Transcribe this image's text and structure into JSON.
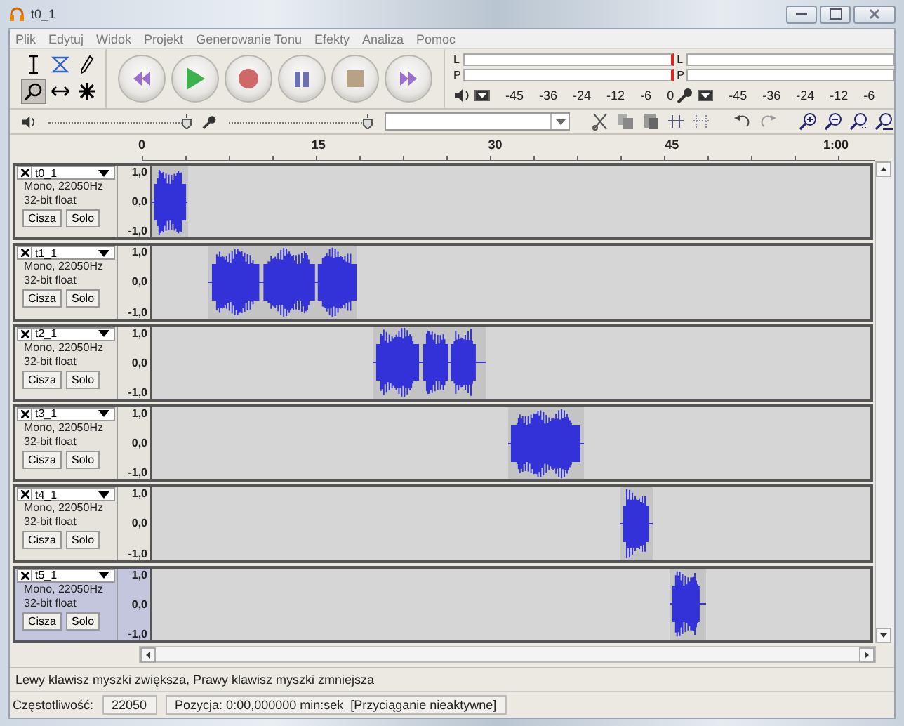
{
  "window": {
    "title": "t0_1"
  },
  "menu": [
    "Plik",
    "Edytuj",
    "Widok",
    "Projekt",
    "Generowanie Tonu",
    "Efekty",
    "Analiza",
    "Pomoc"
  ],
  "tools": [
    {
      "kind": "select",
      "selected": false
    },
    {
      "kind": "envelope",
      "selected": false
    },
    {
      "kind": "draw",
      "selected": false
    },
    {
      "kind": "zoom",
      "selected": true
    },
    {
      "kind": "timeshift",
      "selected": false
    },
    {
      "kind": "multi",
      "selected": false
    }
  ],
  "transport": [
    {
      "kind": "skip-start"
    },
    {
      "kind": "play"
    },
    {
      "kind": "record"
    },
    {
      "kind": "pause"
    },
    {
      "kind": "stop"
    },
    {
      "kind": "skip-end"
    }
  ],
  "meters": [
    {
      "kind": "playback",
      "channels": [
        "L",
        "P"
      ],
      "scale": [
        "-45",
        "-36",
        "-24",
        "-12",
        "-6",
        "0"
      ]
    },
    {
      "kind": "record",
      "channels": [
        "L",
        "P"
      ],
      "scale": [
        "-45",
        "-36",
        "-24",
        "-12",
        "-6"
      ]
    }
  ],
  "mixer": {
    "playback": {
      "level": 0.93
    },
    "record": {
      "level": 0.93
    }
  },
  "ruler": [
    "0",
    "15",
    "30",
    "45",
    "1:00"
  ],
  "tracks": [
    {
      "name": "t0_1",
      "info": "Mono, 22050Hz",
      "format": "32-bit float",
      "buttons": [
        "Cisza",
        "Solo"
      ],
      "scale": [
        "1,0",
        "0,0",
        "-1,0"
      ],
      "selected": false
    },
    {
      "name": "t1_1",
      "info": "Mono, 22050Hz",
      "format": "32-bit float",
      "buttons": [
        "Cisza",
        "Solo"
      ],
      "scale": [
        "1,0",
        "0,0",
        "-1,0"
      ],
      "selected": false
    },
    {
      "name": "t2_1",
      "info": "Mono, 22050Hz",
      "format": "32-bit float",
      "buttons": [
        "Cisza",
        "Solo"
      ],
      "scale": [
        "1,0",
        "0,0",
        "-1,0"
      ],
      "selected": false
    },
    {
      "name": "t3_1",
      "info": "Mono, 22050Hz",
      "format": "32-bit float",
      "buttons": [
        "Cisza",
        "Solo"
      ],
      "scale": [
        "1,0",
        "0,0",
        "-1,0"
      ],
      "selected": false
    },
    {
      "name": "t4_1",
      "info": "Mono, 22050Hz",
      "format": "32-bit float",
      "buttons": [
        "Cisza",
        "Solo"
      ],
      "scale": [
        "1,0",
        "0,0",
        "-1,0"
      ],
      "selected": false
    },
    {
      "name": "t5_1",
      "info": "Mono, 22050Hz",
      "format": "32-bit float",
      "buttons": [
        "Cisza",
        "Solo"
      ],
      "scale": [
        "1,0",
        "0,0",
        "-1,0"
      ],
      "selected": true
    }
  ],
  "status": {
    "hint": "Lewy klawisz myszki zwiększa, Prawy klawisz myszki zmniejsza",
    "rate_label": "Częstotliwość:",
    "rate": "22050",
    "position": "Pozycja: 0:00,000000 min:sek  [Przyciąganie nieaktywne]"
  }
}
